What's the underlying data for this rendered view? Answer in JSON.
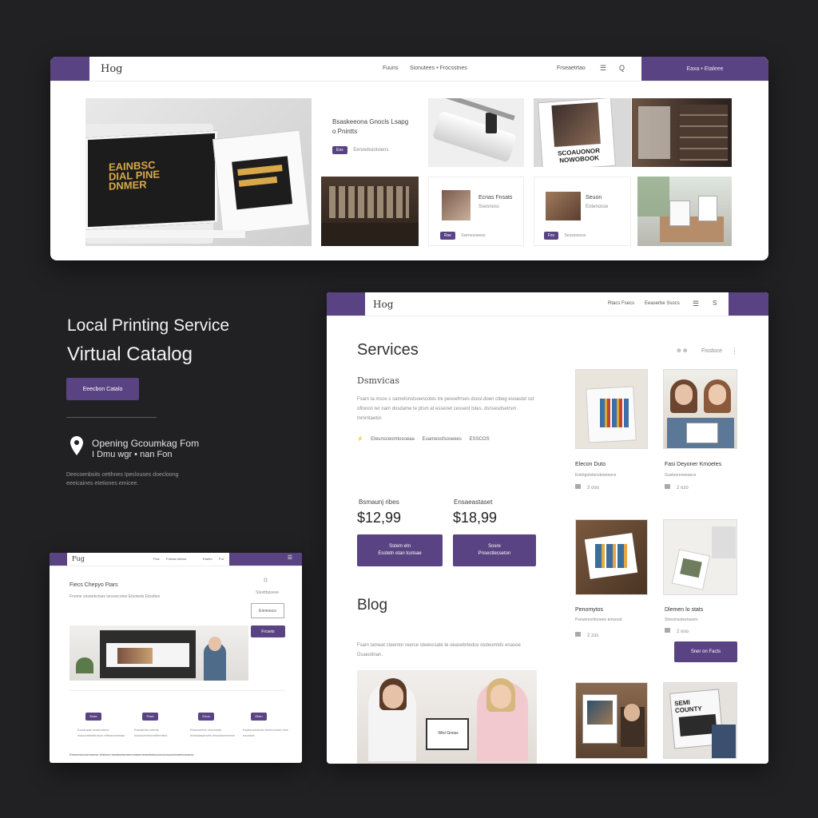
{
  "colors": {
    "accent": "#5a4383",
    "background": "#212023"
  },
  "hero": {
    "title_line1": "Local Printing Service",
    "title_line2": "Virtual Catalog",
    "cta_label": "Eeecbon Catalo",
    "location_icon": "map-pin-icon",
    "location_line1": "Opening Gcoumkag Fom",
    "location_line2": "I Dmu wgr • nan Fon",
    "description": "Deecoenbsits cetthnes Ipeclouses doecloong eeeicaines etetiones emicee."
  },
  "top_window": {
    "logo": "Hog",
    "nav": [
      "Fuuns",
      "Sionutees • Frocsstnes",
      "Frseaetrtao",
      "☰",
      "Q"
    ],
    "nav_button": "Eaxa • Etaleee",
    "promo_text": "Bsaskeeona Gnocls Lsapg o Pnintts",
    "promo_tag": "Eox",
    "promo_meta": "Eenoebsiotsiens",
    "hero_poster_text": "EAINBSC DIAL PINE DNMER",
    "poster_text": "SCOAUONOR NOWOBOOK",
    "cards": [
      {
        "title": "Ecnas Fnsats",
        "subtitle": "Ssesnoss",
        "tag": "Rse",
        "meta": "Ssenesoeees"
      },
      {
        "title": "Seuon",
        "subtitle": "Eotenosse",
        "tag": "Fsv",
        "meta": "Sessnoesss"
      }
    ]
  },
  "main_window": {
    "logo": "Hog",
    "nav": [
      "Rtacs Fsecs",
      "Eeaserbe Ssocs",
      "☰",
      "S"
    ],
    "services_title": "Services",
    "filter_icons": "⊕ ⊕",
    "filter_label": "Fisstoce",
    "more_icon": "⋮",
    "subheading": "Dsmvicas",
    "body_text": "Fsam ta msos s samefonstsoencotes tre pesoefrrses dsosl.doen ctbeg esoastet sst oftonon ter nam dosdame te ptsm at essenet cesseot tstes. dsnsesdsetrsm tnmmtaetor.",
    "meta": [
      "⚡",
      "Eteunsceomtosoeaa",
      "Euameosfsoseees",
      "ESSCOS"
    ],
    "prices": [
      {
        "label": "Bsmaunj ribes",
        "value": "$12,99",
        "button_line1": "Sstem etn",
        "button_line2": "Esstetn etan tcotsae"
      },
      {
        "label": "Ensaeastaset",
        "value": "$18,99",
        "button_line1": "Sosre",
        "button_line2": "Pnsectlecseton"
      }
    ],
    "blog_title": "Blog",
    "blog_text": "Fsam tameat cteentor reerce steeocsate te oeasebrtedce osdeomtds enasoe Dsaeotinan.",
    "blog_sign": "Wisi Gnoss",
    "products": [
      {
        "title": "Elecon Duto",
        "desc": "Eotntgotvtonstreetoons",
        "count": "3 ooo"
      },
      {
        "title": "Fasi Deyoner Kmoetes",
        "desc": "Gustoereneesecs",
        "count": "2 ozo"
      },
      {
        "title": "Penomytos",
        "desc": "Pseutenoritoneen tensoed",
        "count": "2 zos"
      },
      {
        "title": "Dlemen lo stats",
        "desc": "Stresmsoteetseers",
        "count": "2 ooo"
      }
    ],
    "products_button": "Sner on Facts",
    "product_photo_text": "SEMI COUNTY"
  },
  "small_window": {
    "logo": "Fug",
    "nav": [
      "Fios",
      "Foesss stesss",
      "Eaetro",
      "Fot",
      "☰"
    ],
    "heading": "Fiecs Chepyo Ftars",
    "subtext": "Fnome stootebctses tsnearcotee Etsoteds Ebodtes",
    "widget_icon": "ℚ",
    "widget_text": "Stesttbpoese",
    "input_value": "Eonesscs",
    "button": "Frcsets",
    "features": [
      {
        "tag": "Eose",
        "text": "Eauansas eosecoteus essconbestteosoo etteseoesesas"
      },
      {
        "tag": "Pose",
        "text": "Eaesttobs sntmte nsesscemtonettefrettes"
      },
      {
        "tag": "Enoa",
        "text": "Etosossees soerestas ebesstasersets etsaosseoetose"
      },
      {
        "tag": "Ekon",
        "text": "Eaatsoeeosots teeeecomet stse ezosses"
      }
    ],
    "footer": "Ebesresecctroneese ietetces tsesteotsemerecastnneeseitatsceonotorsoscteaetnoeaces"
  }
}
